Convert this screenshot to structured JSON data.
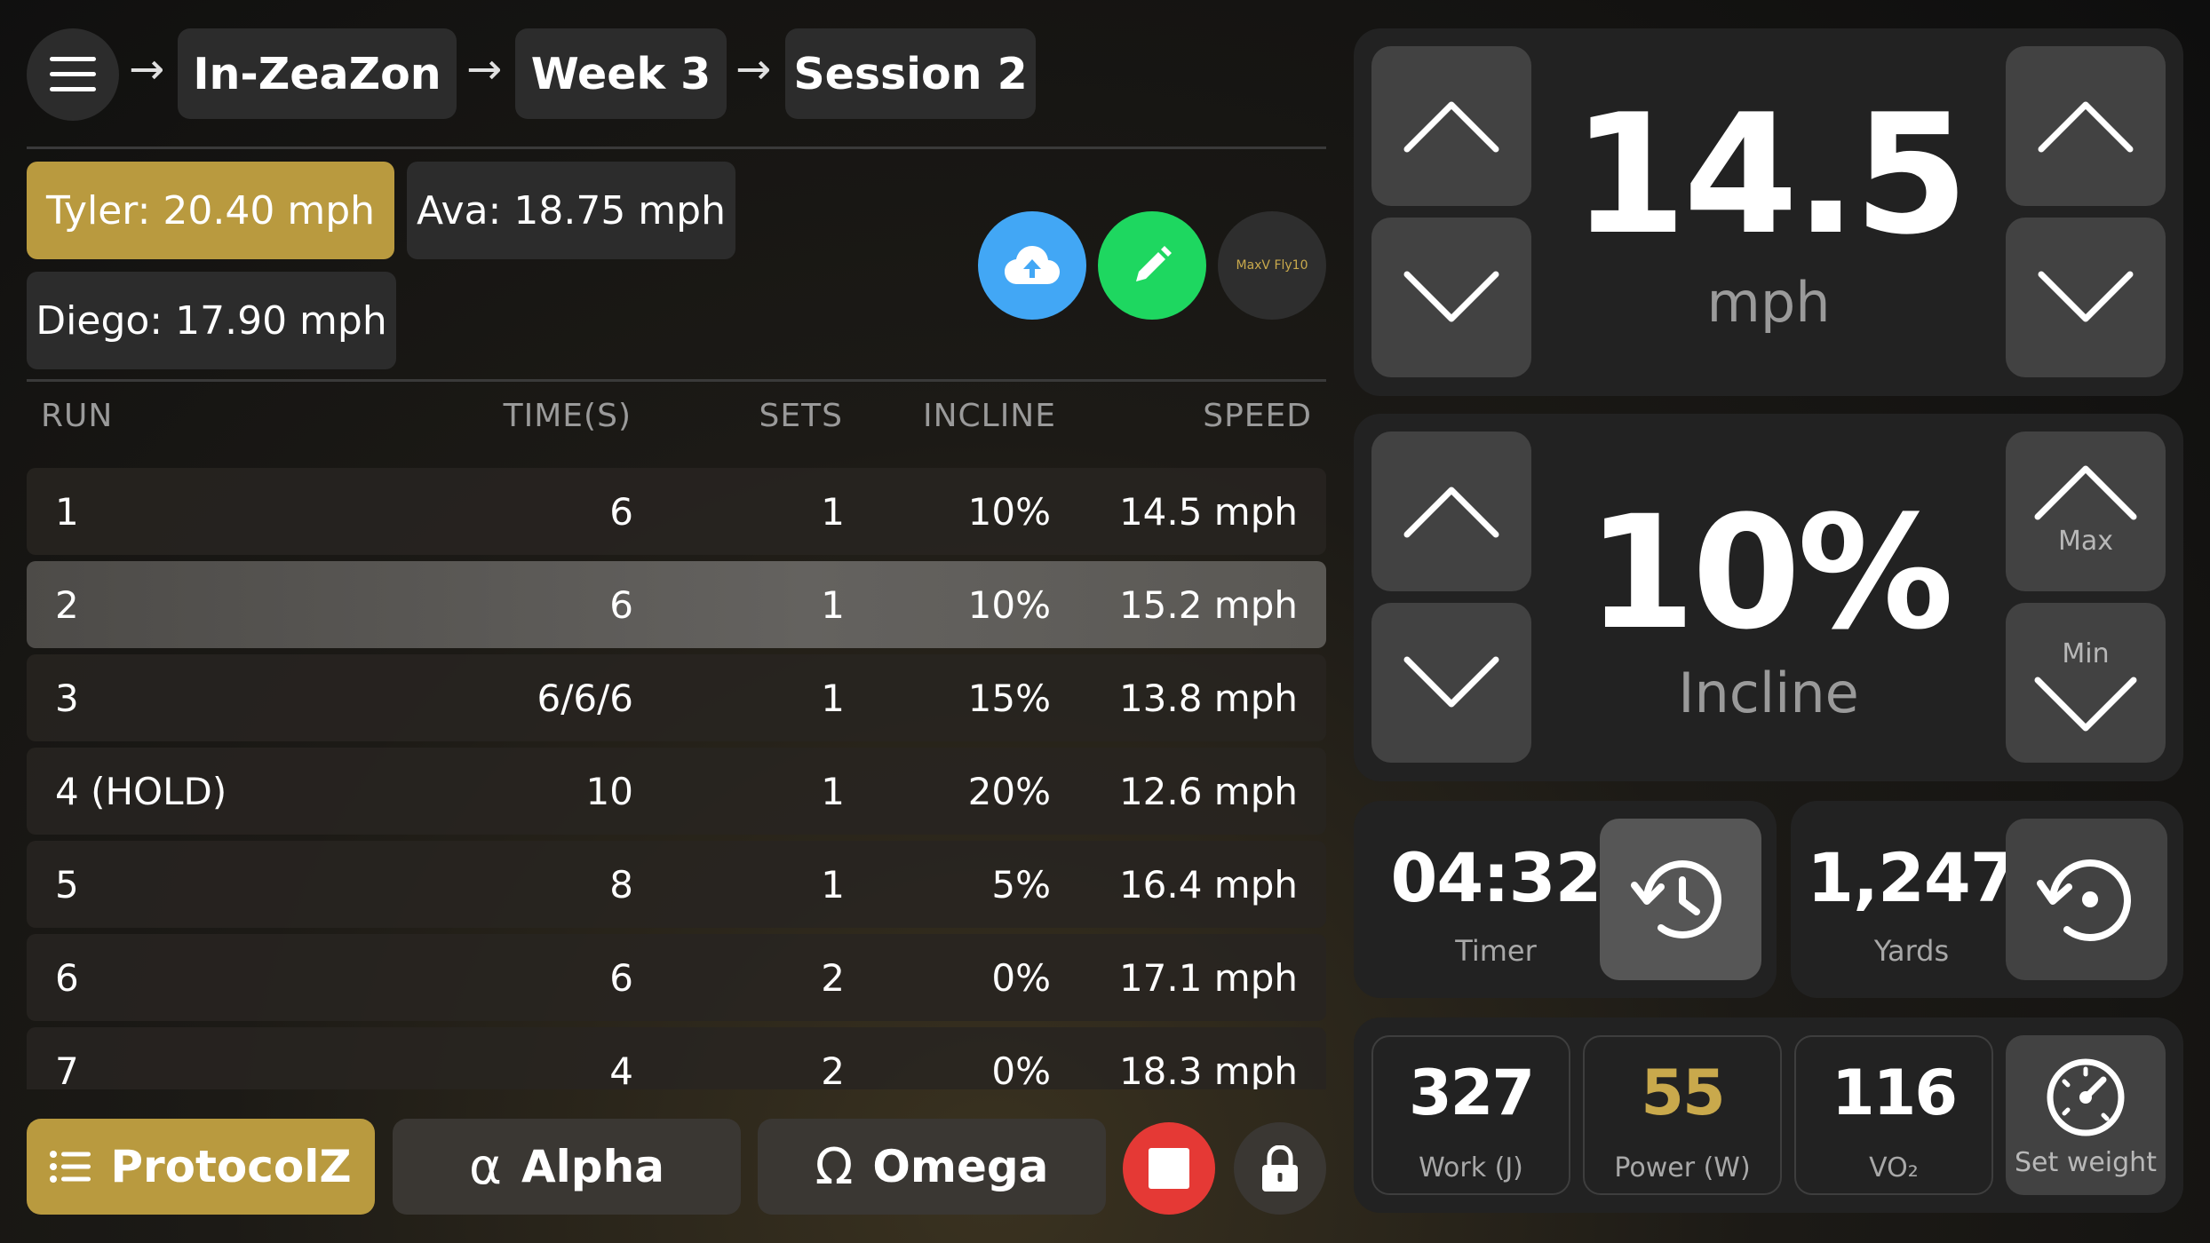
{
  "breadcrumb": {
    "menu_icon": "hamburger-menu-icon",
    "items": [
      "In-ZeaZon",
      "Week 3",
      "Session 2"
    ],
    "separator": "→"
  },
  "athletes": [
    {
      "label": "Tyler: 20.40 mph",
      "active": true
    },
    {
      "label": "Ava: 18.75 mph",
      "active": false
    },
    {
      "label": "Diego: 17.90 mph",
      "active": false
    }
  ],
  "actions": {
    "upload_icon": "cloud-upload-icon",
    "edit_icon": "pencil-icon",
    "logo_text": "MaxV Fly10"
  },
  "table": {
    "headers": {
      "run": "RUN",
      "time": "TIME(S)",
      "sets": "SETS",
      "incline": "INCLINE",
      "speed": "SPEED"
    },
    "rows": [
      {
        "run": "1",
        "time": "6",
        "sets": "1",
        "incline": "10%",
        "speed": "14.5 mph"
      },
      {
        "run": "2",
        "time": "6",
        "sets": "1",
        "incline": "10%",
        "speed": "15.2 mph"
      },
      {
        "run": "3",
        "time": "6/6/6",
        "sets": "1",
        "incline": "15%",
        "speed": "13.8 mph"
      },
      {
        "run": "4 (HOLD)",
        "time": "10",
        "sets": "1",
        "incline": "20%",
        "speed": "12.6 mph"
      },
      {
        "run": "5",
        "time": "8",
        "sets": "1",
        "incline": "5%",
        "speed": "16.4 mph"
      },
      {
        "run": "6",
        "time": "6",
        "sets": "2",
        "incline": "0%",
        "speed": "17.1 mph"
      },
      {
        "run": "7",
        "time": "4",
        "sets": "2",
        "incline": "0%",
        "speed": "18.3 mph"
      }
    ],
    "selected_row": 2
  },
  "bottom": {
    "protocolz": "ProtocolZ",
    "alpha_symbol": "α",
    "alpha": "Alpha",
    "omega_symbol": "Ω",
    "omega": "Omega",
    "stop_icon": "stop-icon",
    "lock_icon": "lock-icon"
  },
  "speed": {
    "value": "14.5",
    "unit": "mph"
  },
  "incline": {
    "value": "10%",
    "unit": "Incline",
    "max_label": "Max",
    "min_label": "Min"
  },
  "timer": {
    "value": "04:32",
    "label": "Timer",
    "icon": "history-icon"
  },
  "yards": {
    "value": "1,247",
    "label": "Yards",
    "icon": "reset-icon"
  },
  "metrics": [
    {
      "value": "327",
      "label": "Work (J)"
    },
    {
      "value": "55",
      "label": "Power (W)"
    },
    {
      "value": "116",
      "label": "VO₂"
    }
  ],
  "set_weight": {
    "label": "Set weight",
    "icon": "gauge-icon"
  },
  "colors": {
    "gold": "#b99a3f",
    "blue": "#42a7f5",
    "green": "#1ed760",
    "red": "#e53935",
    "power_value": "#c9a94c"
  }
}
